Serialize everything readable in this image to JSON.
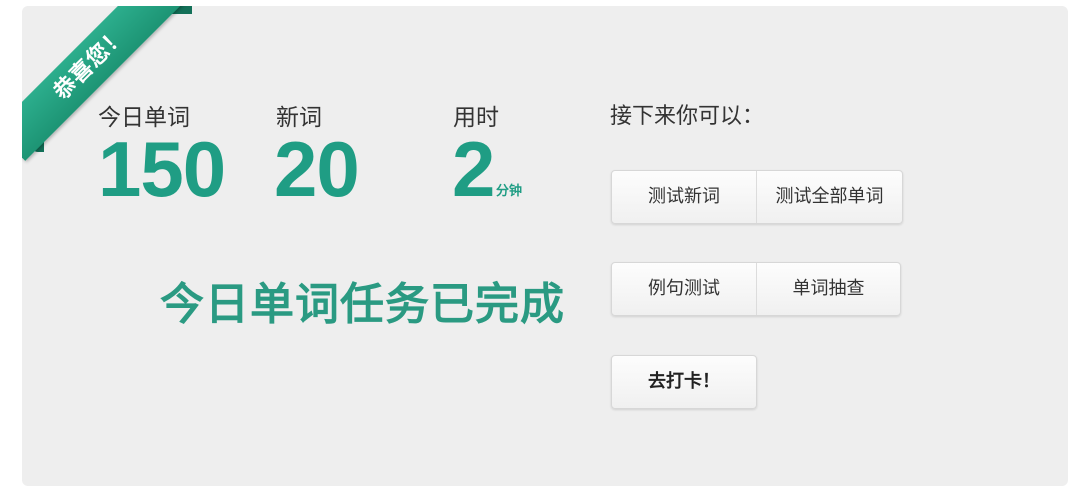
{
  "ribbon": {
    "text": "恭喜您！"
  },
  "stats": [
    {
      "label": "今日单词",
      "value": "150",
      "unit": ""
    },
    {
      "label": "新词",
      "value": "20",
      "unit": ""
    },
    {
      "label": "用时",
      "value": "2",
      "unit": "分钟"
    }
  ],
  "status": {
    "message": "今日单词任务已完成"
  },
  "next": {
    "title": "接下来你可以：",
    "row1": [
      "测试新词",
      "测试全部单词"
    ],
    "row2": [
      "例句测试",
      "单词抽查"
    ],
    "row3": [
      "去打卡！"
    ]
  },
  "colors": {
    "accent": "#1f9d84",
    "ribbon": "#22a383",
    "ribbon_fold": "#137058",
    "card_bg": "#eeeeee"
  }
}
